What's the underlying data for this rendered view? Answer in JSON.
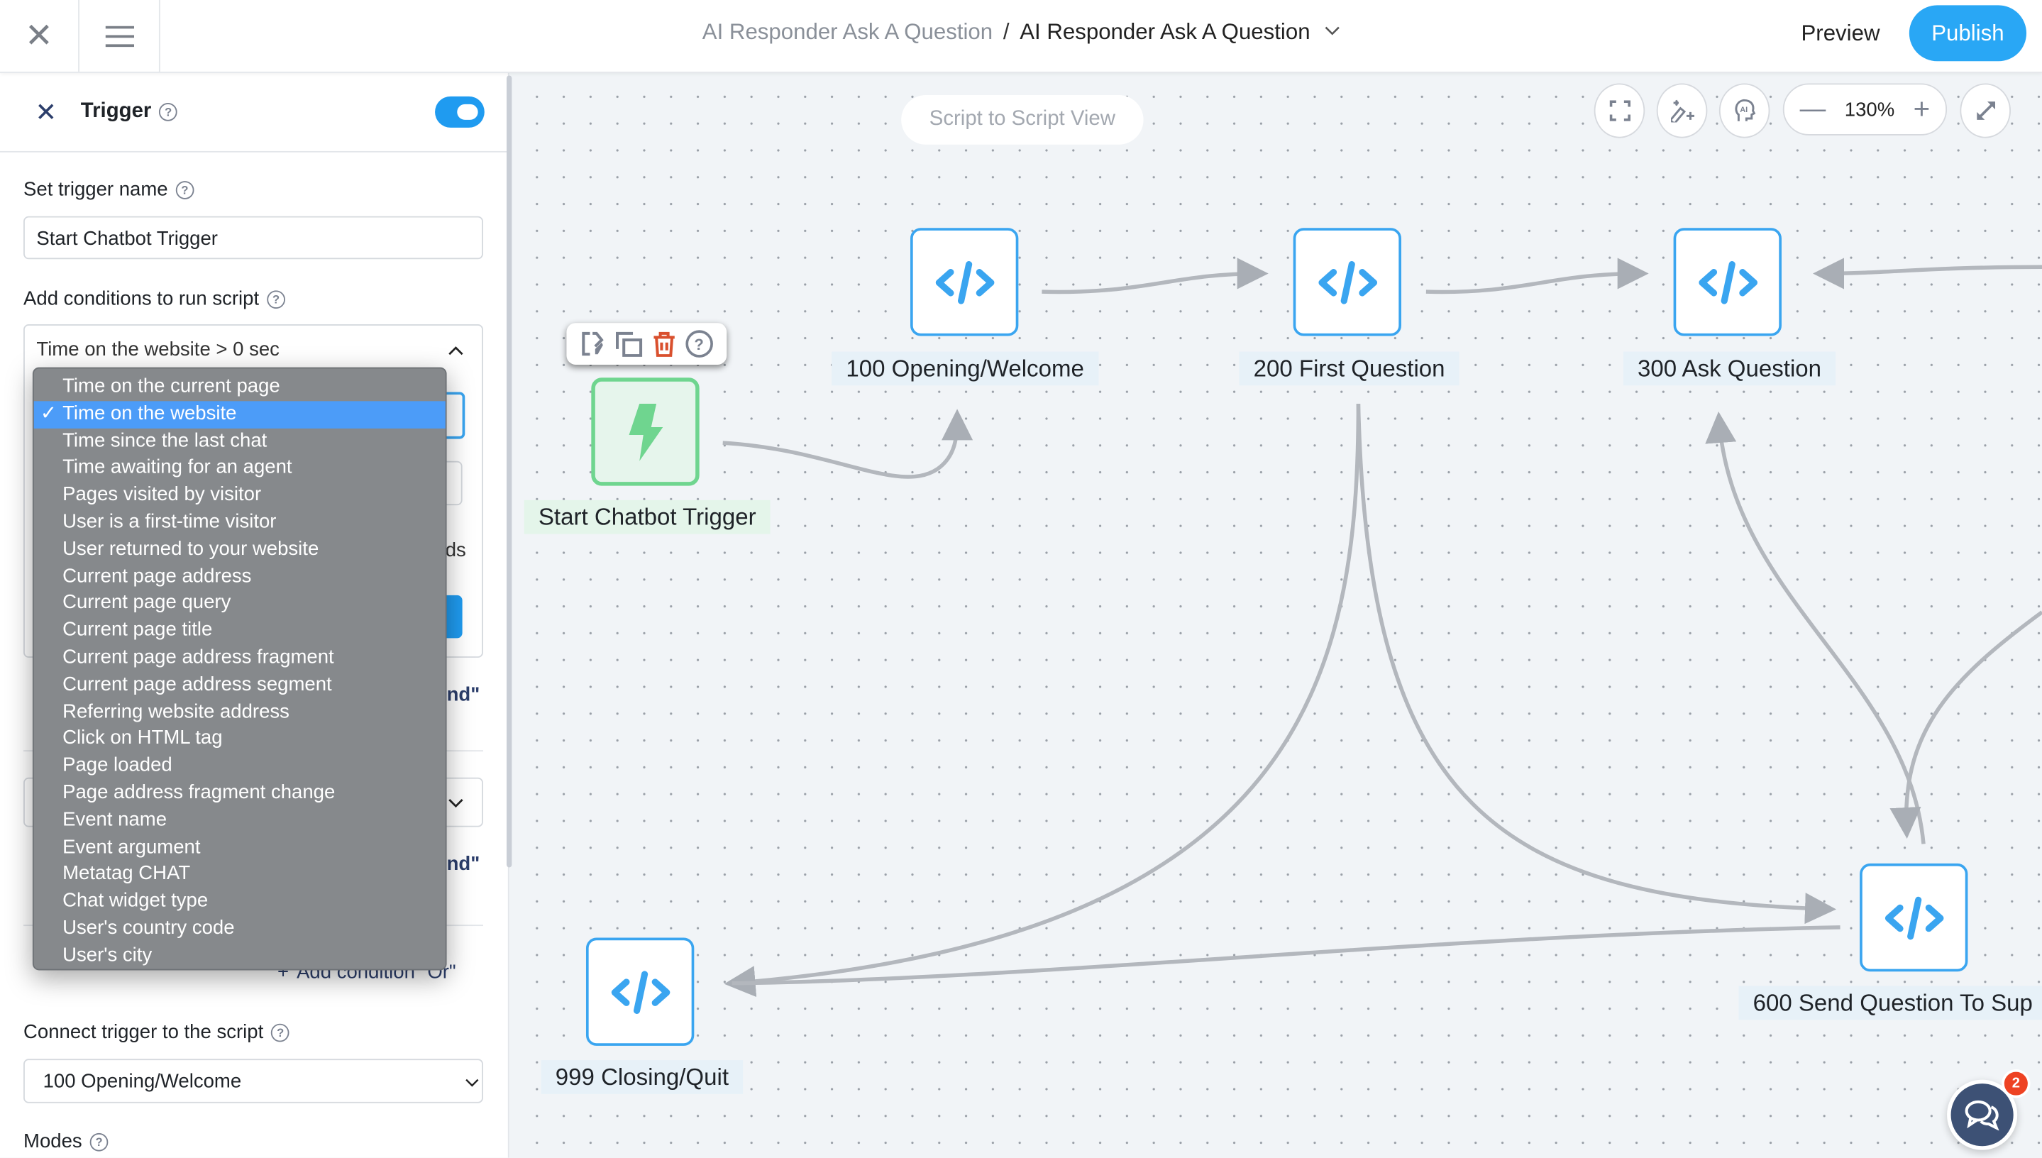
{
  "topbar": {
    "breadcrumb_parent": "AI Responder Ask A Question",
    "breadcrumb_separator": "/",
    "breadcrumb_current": "AI Responder Ask A Question",
    "preview_label": "Preview",
    "publish_label": "Publish"
  },
  "panel": {
    "title": "Trigger",
    "enabled": true,
    "trigger_name_label": "Set trigger name",
    "trigger_name_value": "Start Chatbot Trigger",
    "conditions_label": "Add conditions to run script",
    "condition_summary": "Time on the website > 0 sec",
    "partial_text_1": "ds",
    "partial_text_and_1": "nd\"",
    "partial_text_and_2": "nd\"",
    "add_or_label": "Add condition \"Or\"",
    "connect_label": "Connect trigger to the script",
    "connect_value": "100 Opening/Welcome",
    "modes_label": "Modes",
    "dropdown": {
      "selected": "Time on the website",
      "options": [
        "Time on the current page",
        "Time on the website",
        "Time since the last chat",
        "Time awaiting for an agent",
        "Pages visited by visitor",
        "User is a first-time visitor",
        "User returned to your website",
        "Current page address",
        "Current page query",
        "Current page title",
        "Current page address fragment",
        "Current page address segment",
        "Referring website address",
        "Click on HTML tag",
        "Page loaded",
        "Page address fragment change",
        "Event name",
        "Event argument",
        "Metatag CHAT",
        "Chat widget type",
        "User's country code",
        "User's city"
      ]
    }
  },
  "canvas": {
    "view_toggle_label": "Script to Script View",
    "zoom_level": "130%",
    "nodes": {
      "trigger": "Start Chatbot Trigger",
      "n100": "100 Opening/Welcome",
      "n200": "200 First Question",
      "n300": "300 Ask Question",
      "n600": "600 Send Question To Sup",
      "n999": "999 Closing/Quit"
    },
    "chat_badge_count": "2"
  },
  "colors": {
    "accent": "#29a7f5",
    "trigger_green": "#6fd58f",
    "delete_red": "#d9502e",
    "chat_button": "#3d5175"
  }
}
